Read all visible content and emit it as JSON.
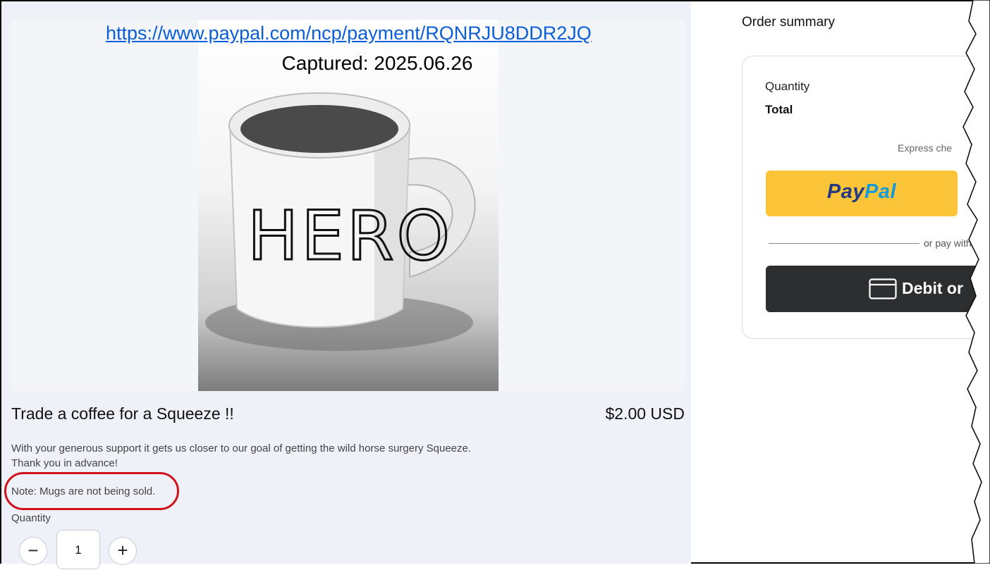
{
  "screenshot": {
    "url": "https://www.paypal.com/ncp/payment/RQNRJU8DDR2JQ",
    "captured": "Captured: 2025.06.26"
  },
  "product": {
    "image_icon": "coffee-mug-photo",
    "mug_text": "HERO",
    "title": "Trade a coffee for a Squeeze !!",
    "price": "$2.00 USD",
    "description_line1": "With your generous support it gets us closer to our goal of getting the wild horse surgery Squeeze.",
    "description_line2": "Thank you in advance!",
    "note": "Note: Mugs are not being sold.",
    "quantity_label": "Quantity",
    "quantity_value": "1",
    "decrement_icon": "minus-icon",
    "increment_icon": "plus-icon",
    "decrement_symbol": "−",
    "increment_symbol": "+"
  },
  "order_summary": {
    "title": "Order summary",
    "quantity_label": "Quantity",
    "total_label": "Total",
    "express_label": "Express che",
    "paypal_part1": "Pay",
    "paypal_part2": "Pal",
    "or_pay_with": "or pay with",
    "debit_label": "Debit or",
    "card_icon": "credit-card-icon"
  },
  "colors": {
    "link": "#0b5ed7",
    "highlight_circle": "#d0121b",
    "paypal_yellow": "#fcc439",
    "paypal_dark_blue": "#253b80",
    "paypal_light_blue": "#179bd7",
    "debit_button": "#2c2e2f"
  }
}
